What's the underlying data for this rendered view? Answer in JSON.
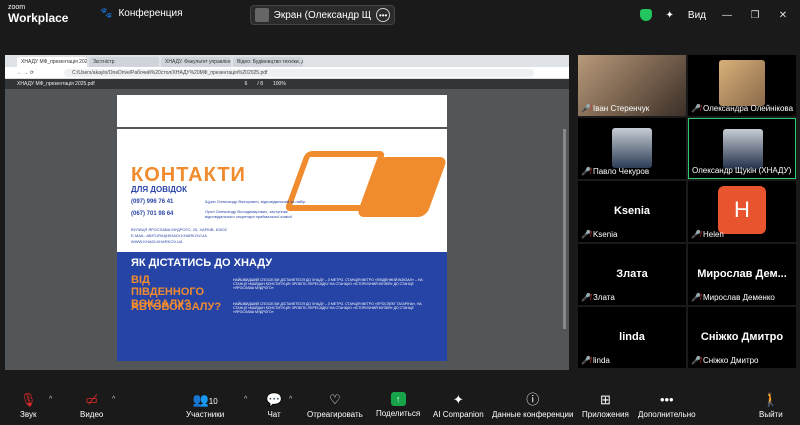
{
  "app": {
    "brand_top": "zoom",
    "brand_bottom": "Workplace"
  },
  "meeting": {
    "title": "Конференция"
  },
  "share_pill": {
    "label": "Экран (Олександр Щукін (ХНАДУ)"
  },
  "top_right": {
    "view_label": "Вид"
  },
  "browser": {
    "tabs": [
      "ХНАДУ МФ_презентація 2025.pdf",
      "Зкстністр",
      "ХНАДУ. Факультет управління...",
      "Відео: Будівництво техніки, досв..."
    ],
    "url": "C:/Users/akaylo/OneDrive/Рабочий%20стол/ХНАДУ%20МФ_презентація%202025.pdf",
    "pdf_name": "ХНАДУ МФ_презентація 2025.pdf",
    "pdf_page": "6",
    "pdf_pages": "/ 8",
    "pdf_zoom": "100%"
  },
  "slide": {
    "title": "КОНТАКТИ",
    "subtitle": "ДЛЯ ДОВІДОК",
    "phone1": "(097) 996 76 41",
    "phone1_desc": "Щукін Олександр Вікторович, відповідальний за набір",
    "phone2": "(067) 701 98 64",
    "phone2_desc": "Орел Олександр Володимирович, заступник відповідального секретаря приймальної комісії",
    "address": "ВУЛИЦЯ ЯРОСЛАВА МУДРОГО, 25, ХАРКІВ, 61002",
    "email": "E-MAIL: ABITURA@KHADI.KHARKOV.UA",
    "web": "WWW.KHADI.KHARKOV.UA",
    "how_title": "ЯК ДІСТАТИСЬ ДО ХНАДУ",
    "q1": "ВІД ПІВДЕННОГО ВОКЗАЛУ?",
    "q1_text": "НАЙШВИДШИЙ СПОСІБ ВИ ДІСТАНЕТЕСЯ ДО ХНАДУ – З МЕТРО. СТАНЦІЯ МЕТРО «ПІВДЕННИЙ ВОКЗАЛ» – НА СТАНЦІЇ «МАЙДАН КОНСТИТУЦІЇ» ЗРОБІТЬ ПЕРЕСАДКУ НА СТАНЦІЮ «ІСТОРИЧНИЙ МУЗЕЙ» ДО СТАНЦІЇ «ЯРОСЛАВА МУДРОГО»",
    "q2": "АВТОВОКЗАЛУ?",
    "q2_text": "НАЙШВИДШИЙ СПОСІБ ВИ ДІСТАНЕТЕСЯ ДО ХНАДУ – З МЕТРО. СТАНЦІЯ МЕТРО «ПРОСПЕКТ ГАГАРІНА», НА СТАНЦІЇ «МАЙДАН КОНСТИТУЦІЇ» ЗРОБІТЬ ПЕРЕСАДКУ НА СТАНЦІЮ «ІСТОРИЧНИЙ МУЗЕЙ» ДО СТАНЦІЇ «ЯРОСЛАВА МУДРОГО»"
  },
  "participants": [
    {
      "name": "Іван Стеренчук",
      "label": "Іван Стеренчук",
      "muted": true
    },
    {
      "name": "Олександра Олейнікова",
      "label": "Олександра Олейнікова",
      "muted": true
    },
    {
      "name": "Павло Чекуров",
      "label": "Павло Чекуров",
      "muted": true
    },
    {
      "name": "Олександр Щукін (ХНАДУ)",
      "label": "Олександр Щукін (ХНАДУ)",
      "muted": false
    },
    {
      "name": "Ksenia",
      "label": "Ksenia",
      "muted": true
    },
    {
      "name": "Helen",
      "label": "Helen",
      "muted": true,
      "initial": "H"
    },
    {
      "name": "Злата",
      "label": "Злата",
      "muted": true
    },
    {
      "name": "Мирослав Дем...",
      "label": "Мирослав Деменко",
      "muted": true
    },
    {
      "name": "linda",
      "label": "linda",
      "muted": true
    },
    {
      "name": "Сніжко Дмитро",
      "label": "Сніжко Дмитро",
      "muted": true
    }
  ],
  "toolbar": {
    "audio": "Звук",
    "video": "Видео",
    "participants": "Участники",
    "participants_count": "10",
    "chat": "Чат",
    "react": "Отреагировать",
    "share": "Поделиться",
    "ai": "AI Companion",
    "info": "Данные конференции",
    "apps": "Приложения",
    "more": "Дополнительно",
    "leave": "Выйти"
  },
  "colors": {
    "accent_orange": "#f08c2e",
    "slide_blue": "#2643a6",
    "active_border": "#2ecc71",
    "muted_red": "#e02c2c",
    "share_green": "#16a34a"
  }
}
